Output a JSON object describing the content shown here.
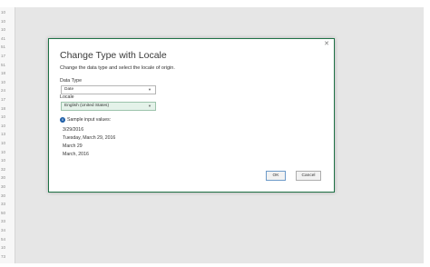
{
  "row_numbers": [
    "10",
    "10",
    "10",
    "41",
    "51",
    "17",
    "51",
    "18",
    "10",
    "24",
    "17",
    "18",
    "10",
    "10",
    "13",
    "10",
    "10",
    "10",
    "32",
    "30",
    "30",
    "30",
    "33",
    "50",
    "33",
    "34",
    "54",
    "10",
    "73"
  ],
  "dialog": {
    "title": "Change Type with Locale",
    "subtitle": "Change the data type and select the locale of origin.",
    "close_glyph": "✕",
    "data_type_label": "Data Type",
    "data_type_value": "Date",
    "locale_label": "Locale",
    "locale_value": "English (United States)",
    "sample_label": "Sample input values:",
    "samples": [
      "3/29/2016",
      "Tuesday, March 29, 2016",
      "March 29",
      "March, 2016"
    ],
    "ok_label": "OK",
    "cancel_label": "Cancel"
  },
  "colors": {
    "dialog_border": "#1e7145",
    "locale_fill": "#e4f2e9",
    "info_icon": "#1f5fa8"
  },
  "icons": {
    "close": "close-icon",
    "info": "info-icon",
    "dropdown": "chevron-down-icon"
  }
}
